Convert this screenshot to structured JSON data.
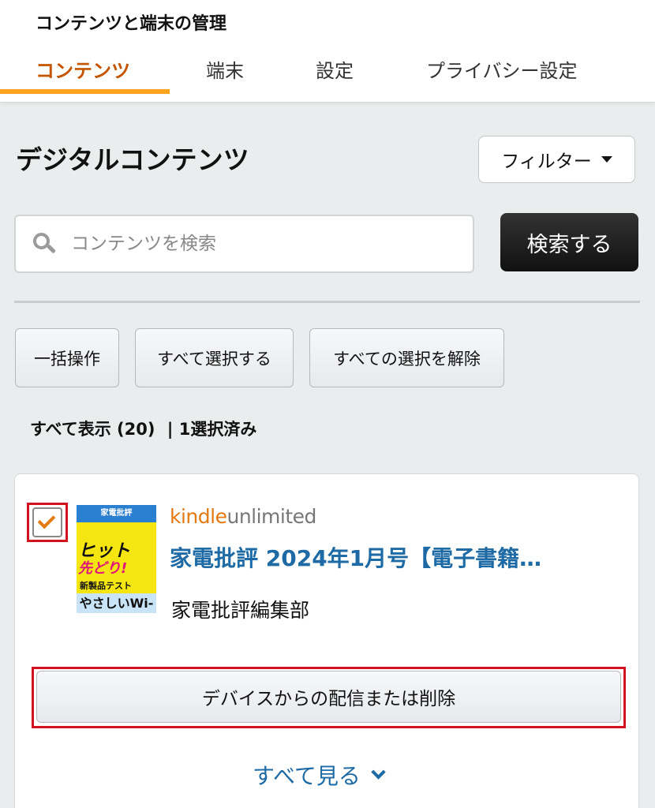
{
  "header": {
    "title": "コンテンツと端末の管理",
    "tabs": [
      {
        "label": "コンテンツ",
        "active": true
      },
      {
        "label": "端末",
        "active": false
      },
      {
        "label": "設定",
        "active": false
      },
      {
        "label": "プライバシー設定",
        "active": false
      }
    ]
  },
  "section": {
    "title": "デジタルコンテンツ",
    "filter_label": "フィルター"
  },
  "search": {
    "placeholder": "コンテンツを検索",
    "value": "",
    "button_label": "検索する"
  },
  "actions": {
    "bulk": "一括操作",
    "select_all": "すべて選択する",
    "deselect_all": "すべての選択を解除"
  },
  "status": {
    "show_all": "すべて表示 (20)",
    "selected": "| 1選択済み"
  },
  "item": {
    "checked": true,
    "badge": {
      "part1": "kindle",
      "part2": "unlimited"
    },
    "title": "家電批評 2024年1月号【電子書籍…",
    "author": "家電批評編集部",
    "cover": {
      "top_text": "家電批評",
      "line1": "ヒット",
      "line2": "先どり!",
      "line3": "新製品テスト",
      "line4": "やさしいWi-Fi"
    },
    "deliver_button": "デバイスからの配信または削除"
  },
  "see_all": "すべて見る",
  "colors": {
    "accent_orange": "#ffa41c",
    "tab_active": "#c45500",
    "link_blue": "#1d6aa5",
    "highlight_red": "#d0131e",
    "check_orange": "#e47911"
  }
}
